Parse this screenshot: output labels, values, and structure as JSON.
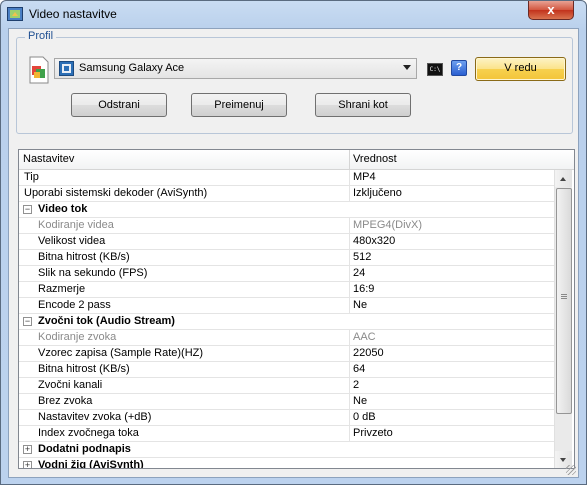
{
  "window": {
    "title": "Video nastavitve",
    "close_label": "x"
  },
  "profile": {
    "legend": "Profil",
    "selected": "Samsung Galaxy Ace",
    "ok_label": "V redu",
    "remove_label": "Odstrani",
    "rename_label": "Preimenuj",
    "save_as_label": "Shrani kot",
    "help_label": "?",
    "cmd_label": "C:\\"
  },
  "grid": {
    "col_name": "Nastavitev",
    "col_value": "Vrednost",
    "rows": [
      {
        "name": "Tip",
        "value": "MP4"
      },
      {
        "name": "Uporabi sistemski dekoder (AviSynth)",
        "value": "Izključeno"
      },
      {
        "name": "Video tok",
        "value": "",
        "expander": "−"
      },
      {
        "name": "Kodiranje videa",
        "value": "MPEG4(DivX)"
      },
      {
        "name": "Velikost videa",
        "value": "480x320"
      },
      {
        "name": "Bitna hitrost (KB/s)",
        "value": "512"
      },
      {
        "name": "Slik na sekundo (FPS)",
        "value": "24"
      },
      {
        "name": "Razmerje",
        "value": "16:9"
      },
      {
        "name": "Encode 2 pass",
        "value": "Ne"
      },
      {
        "name": "Zvočni tok (Audio Stream)",
        "value": "",
        "expander": "−"
      },
      {
        "name": "Kodiranje zvoka",
        "value": "AAC"
      },
      {
        "name": "Vzorec zapisa (Sample Rate)(HZ)",
        "value": "22050"
      },
      {
        "name": "Bitna hitrost (KB/s)",
        "value": "64"
      },
      {
        "name": "Zvočni kanali",
        "value": "2"
      },
      {
        "name": "Brez zvoka",
        "value": "Ne"
      },
      {
        "name": "Nastavitev zvoka (+dB)",
        "value": "0 dB"
      },
      {
        "name": "Index zvočnega toka",
        "value": "Privzeto"
      },
      {
        "name": "Dodatni podnapis",
        "value": "",
        "expander": "+"
      },
      {
        "name": "Vodni žig (AviSynth)",
        "value": "",
        "expander": "+"
      }
    ]
  },
  "scrollbar": {
    "position_fraction": 0.0
  },
  "colors": {
    "title_bar": "#c9dcf2",
    "close_button": "#c2321c",
    "ok_button": "#f7d14e",
    "legend_text": "#1f4f91"
  }
}
